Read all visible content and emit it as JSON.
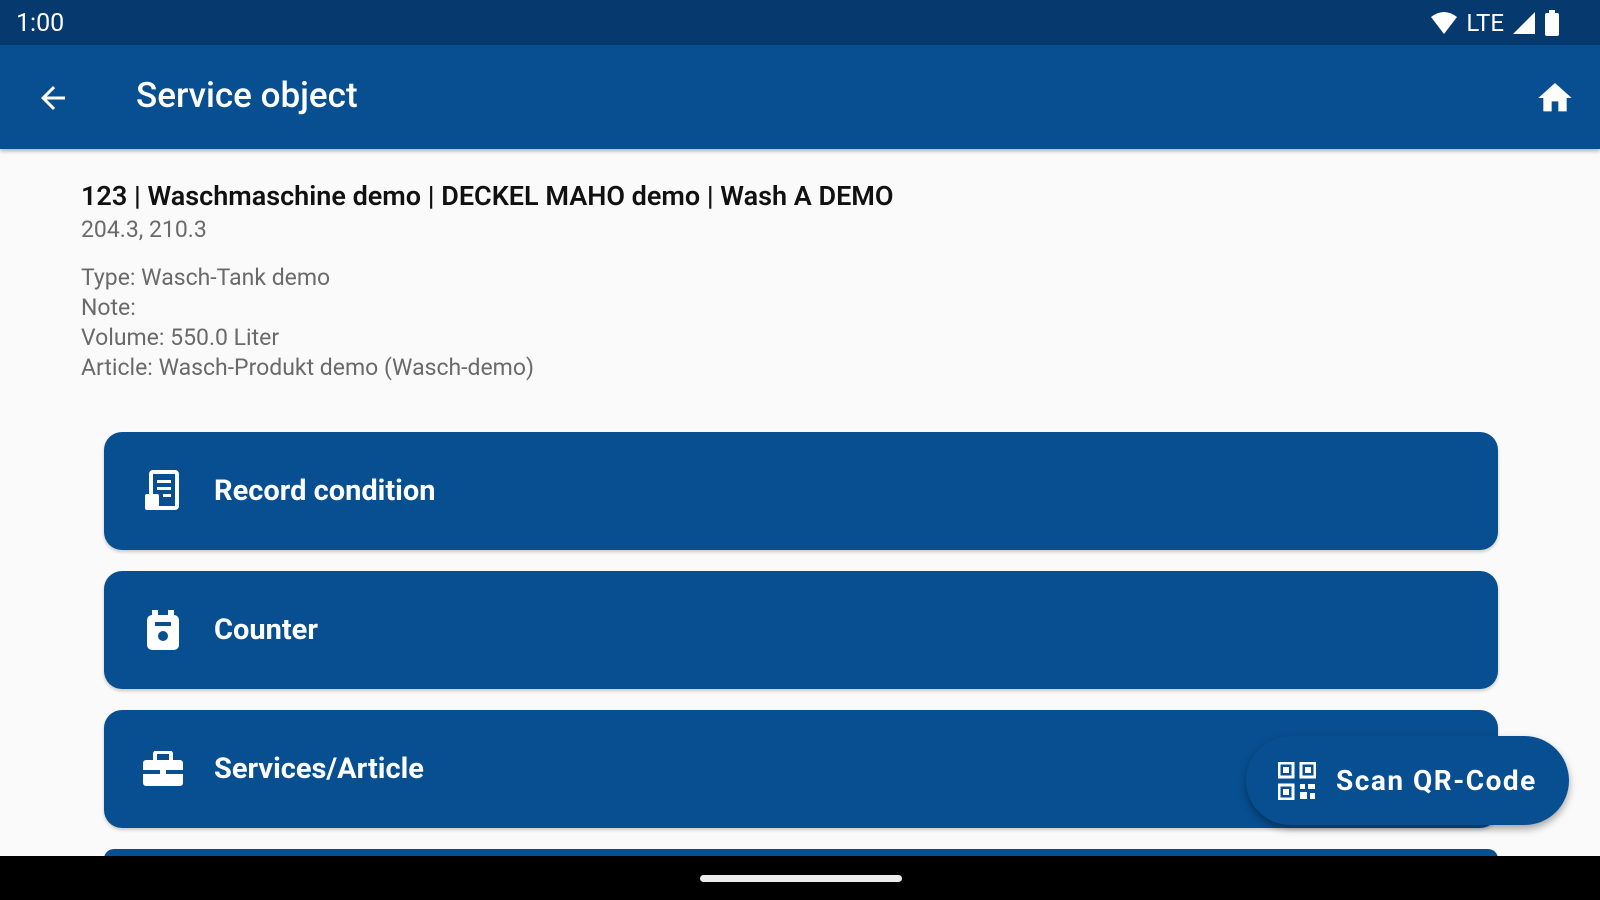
{
  "status_bar": {
    "time": "1:00",
    "network": "LTE",
    "icons": [
      "wifi-icon",
      "signal-icon",
      "battery-icon"
    ]
  },
  "app_bar": {
    "title": "Service object",
    "back_icon": "arrow-left-icon",
    "home_icon": "home-icon"
  },
  "object": {
    "heading": "123 | Waschmaschine demo | DECKEL MAHO demo | Wash A DEMO",
    "subline": "204.3, 210.3",
    "details": [
      "Type: Wasch-Tank demo",
      "Note:",
      "Volume: 550.0 Liter",
      "Article: Wasch-Produkt demo (Wasch-demo)"
    ]
  },
  "actions": [
    {
      "label": "Record condition",
      "icon": "clipboard-list-icon"
    },
    {
      "label": "Counter",
      "icon": "counter-device-icon"
    },
    {
      "label": "Services/Article",
      "icon": "toolbox-icon"
    }
  ],
  "fab": {
    "label": "Scan QR-Code",
    "icon": "qr-code-icon"
  },
  "colors": {
    "status_bar": "#063a6e",
    "primary": "#074f91",
    "background": "#fafafa"
  }
}
